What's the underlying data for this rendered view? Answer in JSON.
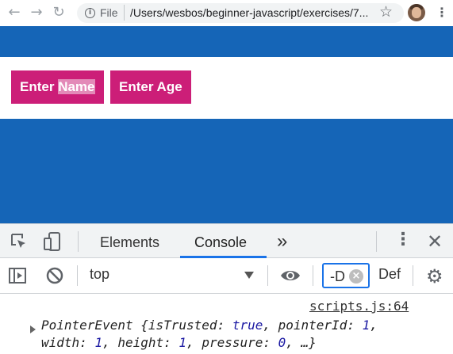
{
  "browser": {
    "url_scheme": "File",
    "url": "/Users/wesbos/beginner-javascript/exercises/7..."
  },
  "page": {
    "buttons": [
      {
        "prefix": "Enter ",
        "selected": "Name"
      },
      {
        "label": "Enter Age"
      }
    ],
    "colors": {
      "background": "#1565b7",
      "button": "#cc1e78"
    }
  },
  "devtools": {
    "tabs": [
      "Elements",
      "Console"
    ],
    "active_tab": "Console",
    "more_tabs": "»",
    "context": "top",
    "filter_value": "-D",
    "levels": "Def"
  },
  "console": {
    "source": "scripts.js:64",
    "line1": {
      "type": "PointerEvent",
      "open": " {",
      "k1": "isTrusted",
      "v1": "true",
      "k2": "pointerId",
      "v2": "1"
    },
    "line2": {
      "k1": "width",
      "v1": "1",
      "k2": "height",
      "v2": "1",
      "k3": "pressure",
      "v3": "0",
      "tail": "…}"
    }
  }
}
